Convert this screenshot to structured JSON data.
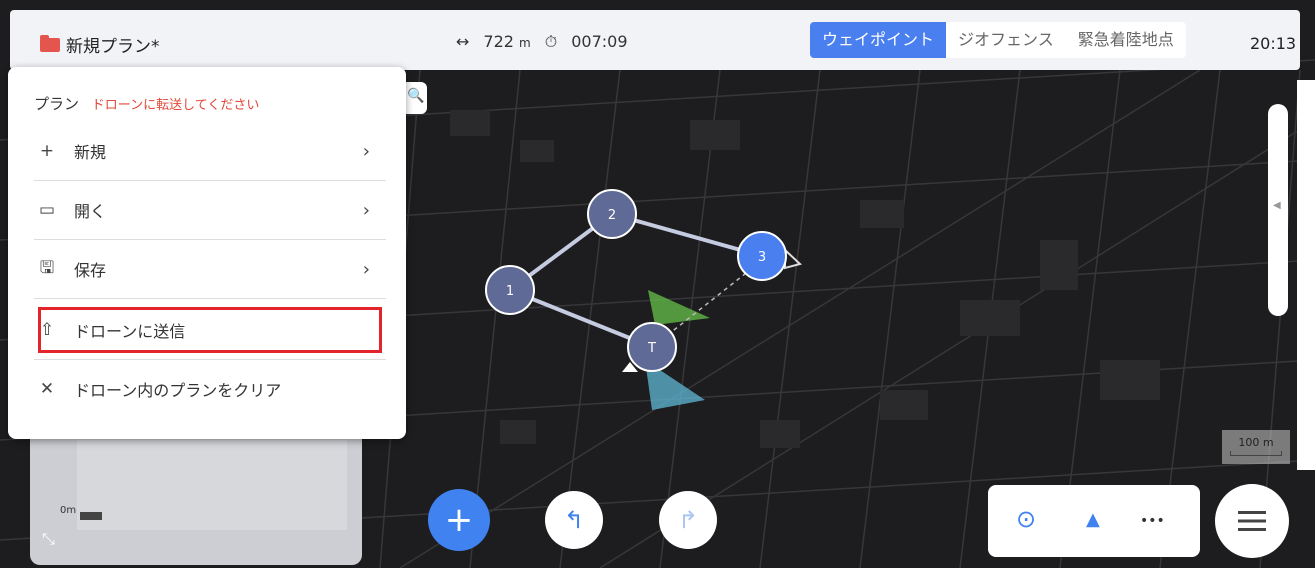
{
  "header": {
    "plan_name": "新規プラン*",
    "distance_prefix": "↔",
    "distance": "722",
    "distance_unit": "m",
    "time_prefix": "⏱",
    "time": "007:09",
    "tabs": [
      {
        "label": "ウェイポイント",
        "active": true
      },
      {
        "label": "ジオフェンス",
        "active": false
      },
      {
        "label": "緊急着陸地点",
        "active": false
      }
    ],
    "clock": "20:13"
  },
  "menu": {
    "title": "プラン",
    "warning": "ドローンに転送してください",
    "items": [
      {
        "label": "新規",
        "icon": "plus-icon",
        "glyph": "+",
        "has_arrow": true
      },
      {
        "label": "開く",
        "icon": "folder-open-icon",
        "glyph": "▭",
        "has_arrow": true
      },
      {
        "label": "保存",
        "icon": "save-icon",
        "glyph": "🖫",
        "has_arrow": true
      },
      {
        "label": "ドローンに送信",
        "icon": "upload-icon",
        "glyph": "⇧",
        "has_arrow": false
      },
      {
        "label": "ドローン内のプランをクリア",
        "icon": "close-icon",
        "glyph": "✕",
        "has_arrow": false
      }
    ]
  },
  "map": {
    "waypoints": [
      "1",
      "2",
      "3",
      "T"
    ],
    "scale_label": "100 m"
  },
  "graph": {
    "zero_label": "0m"
  },
  "controls": {
    "add": "+",
    "undo": "↰",
    "redo": "↱",
    "locate": "⊙",
    "north": "▲",
    "more": "•••"
  },
  "colors": {
    "accent": "#4a7ff0",
    "warning": "#e14838",
    "highlight": "#e3242b",
    "folder": "#e4554d"
  }
}
